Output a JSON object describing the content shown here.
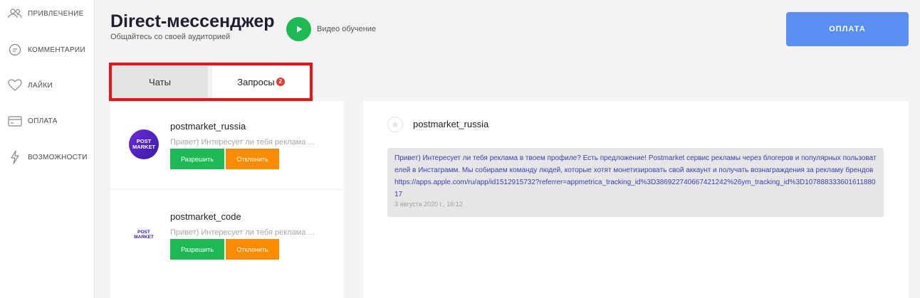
{
  "sidebar": {
    "items": [
      {
        "label": "ПРИВЛЕЧЕНИЕ",
        "icon": "users-icon"
      },
      {
        "label": "КОММЕНТАРИИ",
        "icon": "comment-icon"
      },
      {
        "label": "ЛАЙКИ",
        "icon": "heart-icon"
      },
      {
        "label": "ОПЛАТА",
        "icon": "card-icon"
      },
      {
        "label": "ВОЗМОЖНОСТИ",
        "icon": "lightning-icon"
      }
    ]
  },
  "header": {
    "title": "Direct-мессенджер",
    "subtitle": "Общайтесь со своей аудиторией",
    "video_label": "Видео обучение",
    "pay_label": "ОПЛАТА"
  },
  "tabs": {
    "chats": "Чаты",
    "requests": "Запросы",
    "requests_badge": "2"
  },
  "requests": [
    {
      "name": "postmarket_russia",
      "preview": "Привет) Интересует ли тебя реклама ...",
      "allow": "Разрешить",
      "decline": "Отклонить",
      "logo_top": "POST",
      "logo_bottom": "MARKET"
    },
    {
      "name": "postmarket_code",
      "preview": "Привет) Интересует ли тебя реклама ...",
      "allow": "Разрешить",
      "decline": "Отклонить",
      "logo_top": "POST",
      "logo_bottom": "MARKET"
    }
  ],
  "conversation": {
    "name": "postmarket_russia",
    "message": "Привет) Интересует ли тебя реклама в твоем профиле? Есть предложение! Postmarket сервис рекламы через блогеров и популярных пользователей в Инстаграмм. Мы собираем команду людей, которые хотят монетизировать свой аккаунт и получать вознаграждения за рекламу брендов https://apps.apple.com/ru/app/id1512915732?referrer=appmetrica_tracking_id%3D386922740667421242%26ym_tracking_id%3D10788833360161188017",
    "time": "3 августа 2020 г., 16:12"
  },
  "colors": {
    "accent_blue": "#5b8ff4",
    "green": "#1db954",
    "orange": "#fb8c00",
    "highlight_red": "#ee1111"
  }
}
